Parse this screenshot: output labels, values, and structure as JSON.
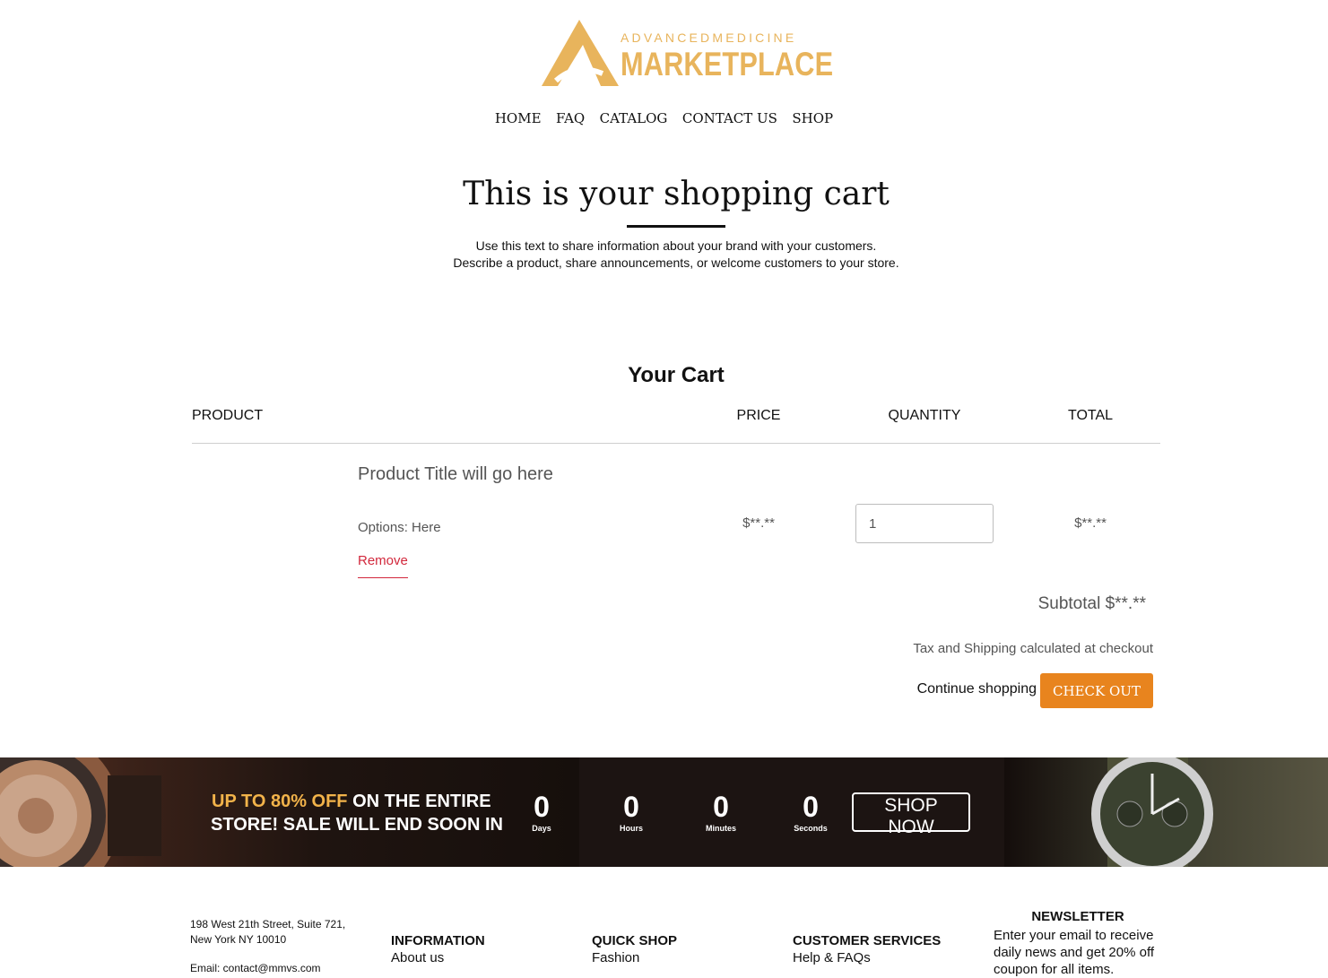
{
  "brand": {
    "top_text": "ADVANCEDMEDICINE",
    "main_text": "MARKETPLACE"
  },
  "nav": {
    "items": [
      "HOME",
      "FAQ",
      "CATALOG",
      "CONTACT US",
      "SHOP"
    ]
  },
  "hero": {
    "title": "This is your shopping cart",
    "line1": "Use this text to share information about your brand with your customers.",
    "line2": "Describe a product, share announcements, or welcome customers to your store."
  },
  "cart": {
    "title": "Your Cart",
    "columns": [
      "PRODUCT",
      "PRICE",
      "QUANTITY",
      "TOTAL"
    ],
    "item": {
      "title": "Product Title will go here",
      "options": "Options: Here",
      "remove_label": "Remove",
      "price": "$**.**",
      "quantity": "1",
      "total": "$**.**"
    },
    "subtotal": "Subtotal $**.**",
    "tax_note": "Tax and Shipping calculated at checkout",
    "continue_label": "Continue shopping",
    "checkout_label": "CHECK OUT"
  },
  "promo": {
    "highlight": "UP TO 80% OFF",
    "line1_rest": " ON THE ENTIRE",
    "line2": "STORE! SALE WILL END SOON IN",
    "countdown": [
      {
        "value": "0",
        "label": "Days"
      },
      {
        "value": "0",
        "label": "Hours"
      },
      {
        "value": "0",
        "label": "Minutes"
      },
      {
        "value": "0",
        "label": "Seconds"
      }
    ],
    "button_label": "SHOP NOW"
  },
  "footer": {
    "address_line1": "198 West 21th Street, Suite 721,",
    "address_line2": "New York NY 10010",
    "email_line": "Email: contact@mmvs.com",
    "information": {
      "heading": "INFORMATION",
      "first_link": "About us"
    },
    "quick_shop": {
      "heading": "QUICK SHOP",
      "first_link": "Fashion"
    },
    "customer_services": {
      "heading": "CUSTOMER SERVICES",
      "first_link": "Help & FAQs"
    },
    "newsletter": {
      "heading": "NEWSLETTER",
      "text": "Enter your email to receive daily news and get 20% off coupon for all items."
    }
  },
  "colors": {
    "brand_gold": "#e8b45c",
    "checkout_orange": "#e8841e",
    "remove_red": "#d2283c",
    "promo_highlight": "#f2b34a"
  }
}
